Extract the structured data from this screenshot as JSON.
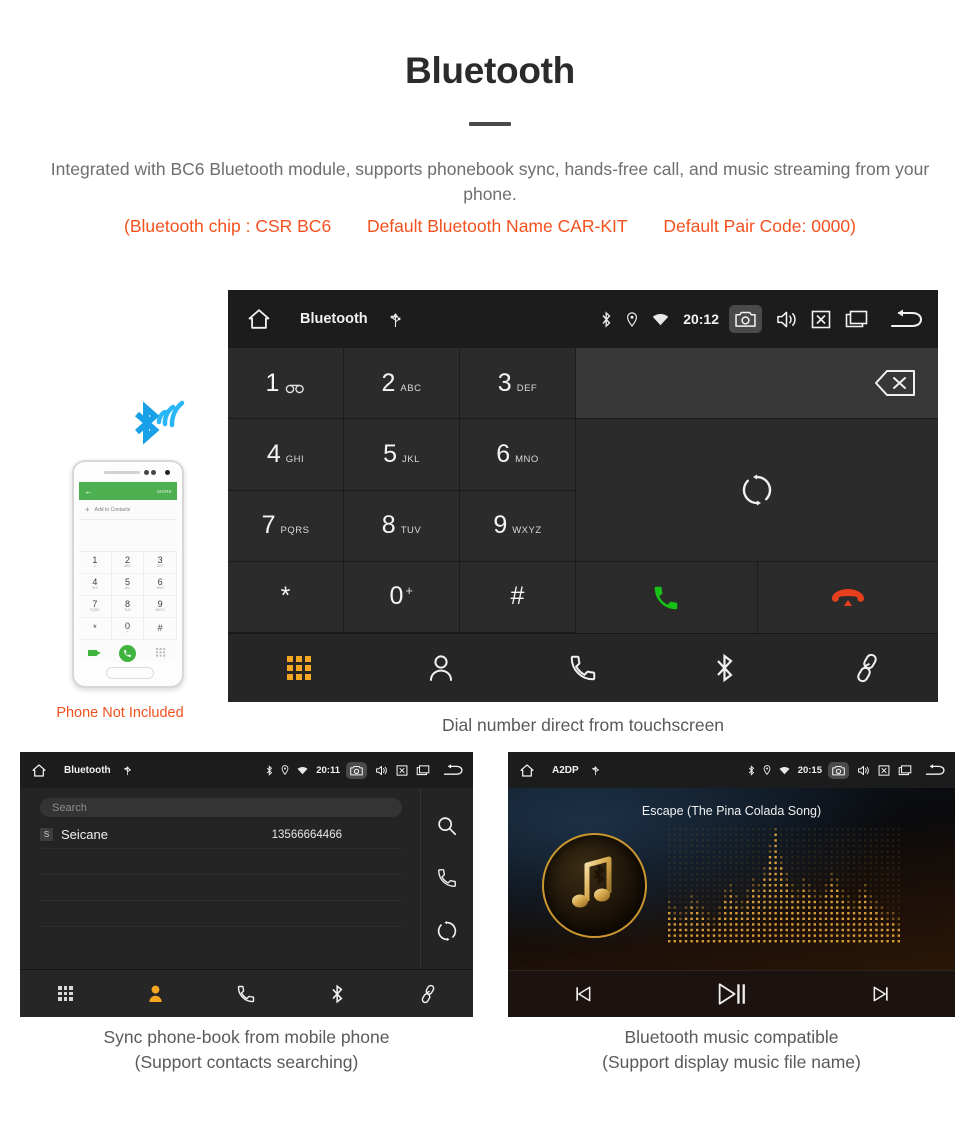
{
  "header": {
    "title": "Bluetooth",
    "description": "Integrated with BC6 Bluetooth module, supports phonebook sync, hands-free call, and music streaming from your phone.",
    "spec_chip": "(Bluetooth chip : CSR BC6",
    "spec_name": "Default Bluetooth Name CAR-KIT",
    "spec_pair": "Default Pair Code: 0000)",
    "accent_color": "#f4511e",
    "body_color": "#6e6e6e"
  },
  "phone_mockup": {
    "note": "Phone Not Included",
    "appbar_more": "MORE",
    "appbar_back": "←",
    "add_contacts": "Add to Contacts",
    "plus": "+",
    "keys": [
      {
        "num": "1",
        "sub": "∞"
      },
      {
        "num": "2",
        "sub": "ABC"
      },
      {
        "num": "3",
        "sub": "DEF"
      },
      {
        "num": "4",
        "sub": "GHI"
      },
      {
        "num": "5",
        "sub": "JKL"
      },
      {
        "num": "6",
        "sub": "MNO"
      },
      {
        "num": "7",
        "sub": "PQRS"
      },
      {
        "num": "8",
        "sub": "TUV"
      },
      {
        "num": "9",
        "sub": "WXYZ"
      },
      {
        "num": "*",
        "sub": ""
      },
      {
        "num": "0",
        "sub": "+"
      },
      {
        "num": "#",
        "sub": ""
      }
    ],
    "bluetooth_logo_color": "#18a0e8"
  },
  "dialer": {
    "statusbar": {
      "title": "Bluetooth",
      "time": "20:12",
      "icons": [
        "home-icon",
        "usb-icon",
        "bluetooth-icon",
        "location-icon",
        "wifi-icon",
        "camera-icon",
        "volume-icon",
        "close-box-icon",
        "recents-icon",
        "back-icon"
      ]
    },
    "keys": [
      {
        "num": "1",
        "sub": "",
        "voicemail": true
      },
      {
        "num": "2",
        "sub": "ABC"
      },
      {
        "num": "3",
        "sub": "DEF"
      },
      {
        "num": "4",
        "sub": "GHI"
      },
      {
        "num": "5",
        "sub": "JKL"
      },
      {
        "num": "6",
        "sub": "MNO"
      },
      {
        "num": "7",
        "sub": "PQRS"
      },
      {
        "num": "8",
        "sub": "TUV"
      },
      {
        "num": "9",
        "sub": "WXYZ"
      },
      {
        "num": "*",
        "sub": ""
      },
      {
        "num": "0",
        "sub": "+",
        "sup": true
      },
      {
        "num": "#",
        "sub": ""
      }
    ],
    "number_display": "",
    "nav": [
      "dialpad-icon",
      "contacts-icon",
      "call-log-icon",
      "bluetooth-icon",
      "link-icon"
    ],
    "active_nav": "dialpad-icon",
    "active_color": "#f5a623",
    "call_color": "#17c217",
    "end_call_color": "#e8401c",
    "caption": "Dial number direct from touchscreen"
  },
  "phonebook": {
    "statusbar": {
      "title": "Bluetooth",
      "time": "20:11"
    },
    "search_placeholder": "Search",
    "contacts": [
      {
        "initial": "S",
        "name": "Seicane",
        "number": "13566664466"
      }
    ],
    "side_actions": [
      "search-icon",
      "call-icon",
      "sync-icon"
    ],
    "nav": [
      "dialpad-icon",
      "contacts-icon",
      "call-log-icon",
      "bluetooth-icon",
      "link-icon"
    ],
    "active_nav": "contacts-icon",
    "caption_line1": "Sync phone-book from mobile phone",
    "caption_line2": "(Support contacts searching)"
  },
  "music": {
    "statusbar": {
      "title": "A2DP",
      "time": "20:15"
    },
    "track_name": "Escape (The Pina Colada Song)",
    "controls": [
      "previous-icon",
      "play-pause-icon",
      "next-icon"
    ],
    "artwork_icon": "music-note-bluetooth-icon",
    "accent_color": "#c9962f",
    "caption_line1": "Bluetooth music compatible",
    "caption_line2": "(Support display music file name)"
  }
}
